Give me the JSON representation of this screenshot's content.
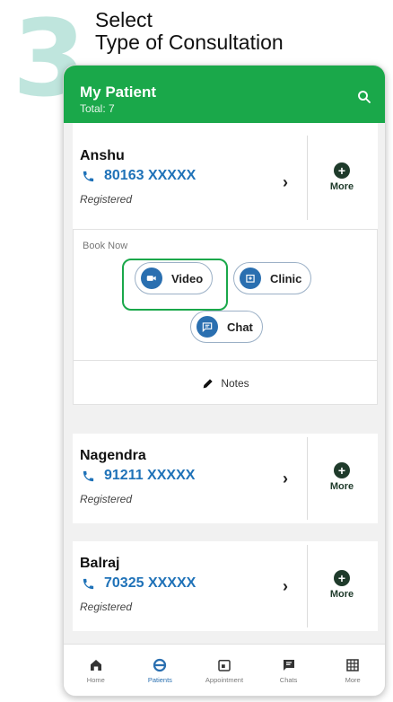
{
  "step": {
    "number": "3",
    "line1": "Select",
    "line2": "Type of Consultation"
  },
  "appbar": {
    "title": "My Patient",
    "subtitle": "Total: 7",
    "search_icon": "search-icon"
  },
  "patients": [
    {
      "name": "Anshu",
      "phone": "80163 XXXXX",
      "status": "Registered",
      "more": "More"
    },
    {
      "name": "Nagendra",
      "phone": "91211 XXXXX",
      "status": "Registered",
      "more": "More"
    },
    {
      "name": "Balraj",
      "phone": "70325 XXXXX",
      "status": "Registered",
      "more": "More"
    }
  ],
  "book": {
    "label": "Book Now",
    "video": "Video",
    "clinic": "Clinic",
    "chat": "Chat",
    "notes": "Notes"
  },
  "tabs": [
    {
      "label": "Home",
      "icon": "home-icon"
    },
    {
      "label": "Patients",
      "icon": "patients-icon"
    },
    {
      "label": "Appointment",
      "icon": "calendar-icon"
    },
    {
      "label": "Chats",
      "icon": "chat-icon"
    },
    {
      "label": "More",
      "icon": "grid-icon"
    }
  ],
  "colors": {
    "primary": "#1aa84a",
    "link": "#1f72b8",
    "accent_bg": "#bfe5dd"
  }
}
